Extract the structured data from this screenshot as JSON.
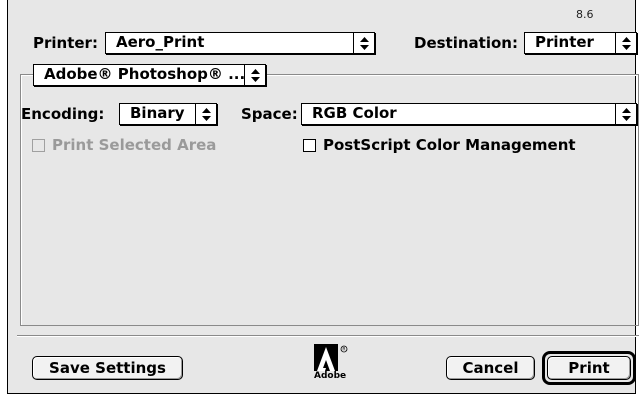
{
  "version": "8.6",
  "header": {
    "printer_label": "Printer:",
    "printer_value": "Aero_Print",
    "destination_label": "Destination:",
    "destination_value": "Printer"
  },
  "panel": {
    "selector_value": "Adobe® Photoshop® ...",
    "encoding_label": "Encoding:",
    "encoding_value": "Binary",
    "space_label": "Space:",
    "space_value": "RGB Color",
    "print_selected_area_label": "Print Selected Area",
    "print_selected_area_checked": false,
    "print_selected_area_enabled": false,
    "postscript_cm_label": "PostScript Color Management",
    "postscript_cm_checked": false
  },
  "footer": {
    "save_settings_label": "Save Settings",
    "logo_text": "Adobe",
    "cancel_label": "Cancel",
    "print_label": "Print"
  },
  "icons": {
    "popup_arrows": "updown-arrows-icon",
    "logo": "adobe-logo"
  }
}
